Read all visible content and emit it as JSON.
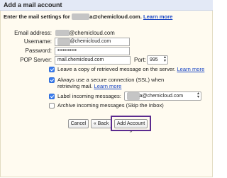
{
  "window": {
    "title": "Add a mail account"
  },
  "instruction": {
    "prefix": "Enter the mail settings for ",
    "email_redacted": "xxxxxx",
    "email_suffix": "a@chemicloud.com.",
    "learn_more": "Learn more"
  },
  "form": {
    "email_label": "Email address:",
    "email_redacted": "xxxxx",
    "email_suffix": "@chemicloud.com",
    "username_label": "Username:",
    "username_redacted": "xxxxx",
    "username_suffix": "@chemicloud.com",
    "password_label": "Password:",
    "password_value": "•••••••••••",
    "pop_label": "POP Server:",
    "pop_value": "mail.chemicloud.com",
    "port_label": "Port:",
    "port_value": "995"
  },
  "options": {
    "leave_copy": {
      "label": "Leave a copy of retrieved message on the server.",
      "link": "Learn more",
      "checked": true
    },
    "ssl": {
      "label": "Always use a secure connection (SSL) when retrieving mail.",
      "link": "Learn more",
      "checked": true
    },
    "label_incoming": {
      "label": "Label incoming messages:",
      "select_redacted": "xxxxx",
      "select_suffix": "a@chemicloud.com",
      "checked": true
    },
    "archive": {
      "label": "Archive incoming messages (Skip the Inbox)",
      "checked": false
    }
  },
  "buttons": {
    "cancel": "Cancel",
    "back": "« Back",
    "add_account": "Add Account »"
  },
  "colors": {
    "highlight": "#5b2b8f",
    "link": "#1a46c4",
    "checkbox": "#3a7df0"
  }
}
